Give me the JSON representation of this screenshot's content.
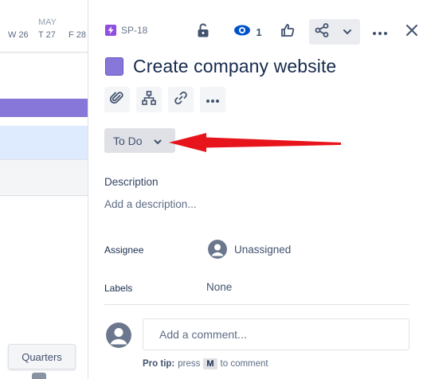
{
  "timeline": {
    "month": "MAY",
    "days": [
      "W 26",
      "T 27",
      "F 28"
    ],
    "quarters_label": "Quarters",
    "colors": {
      "epic_bar": "#8777d9",
      "selected_row": "#deebff"
    }
  },
  "issue": {
    "key": "SP-18",
    "type_icon": "epic-lightning-icon",
    "title": "Create company website",
    "epic_color": "#8777d9"
  },
  "header": {
    "lock_icon": "unlock-icon",
    "watch_icon": "eye-icon",
    "watch_count": "1",
    "like_icon": "thumbs-up-icon",
    "share_icon": "share-icon",
    "more_icon": "more-icon",
    "close_icon": "close-icon"
  },
  "toolbar": {
    "attach_icon": "paperclip-icon",
    "child_icon": "hierarchy-icon",
    "link_icon": "link-icon",
    "more_icon": "more-icon"
  },
  "status": {
    "label": "To Do"
  },
  "description": {
    "label": "Description",
    "placeholder": "Add a description..."
  },
  "fields": {
    "assignee": {
      "label": "Assignee",
      "value": "Unassigned"
    },
    "labels": {
      "label": "Labels",
      "value": "None"
    }
  },
  "comment": {
    "placeholder": "Add a comment...",
    "tip_prefix": "Pro tip:",
    "tip_press": "press",
    "tip_key": "M",
    "tip_suffix": "to comment"
  },
  "annotation": {
    "arrow_color": "#e8141c"
  }
}
